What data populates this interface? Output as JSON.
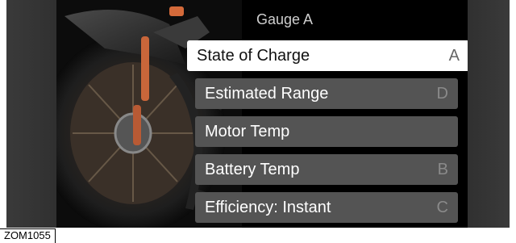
{
  "gauge": {
    "title": "Gauge A",
    "items": [
      {
        "label": "State of Charge",
        "slot": "A",
        "selected": true
      },
      {
        "label": "Estimated Range",
        "slot": "D",
        "selected": false
      },
      {
        "label": "Motor Temp",
        "slot": "",
        "selected": false
      },
      {
        "label": "Battery Temp",
        "slot": "B",
        "selected": false
      },
      {
        "label": "Efficiency: Instant",
        "slot": "C",
        "selected": false
      }
    ]
  },
  "caption": "ZOM1055",
  "colors": {
    "selected_bg": "#ffffff",
    "item_bg": "#545454",
    "accent": "#d46a3a"
  }
}
